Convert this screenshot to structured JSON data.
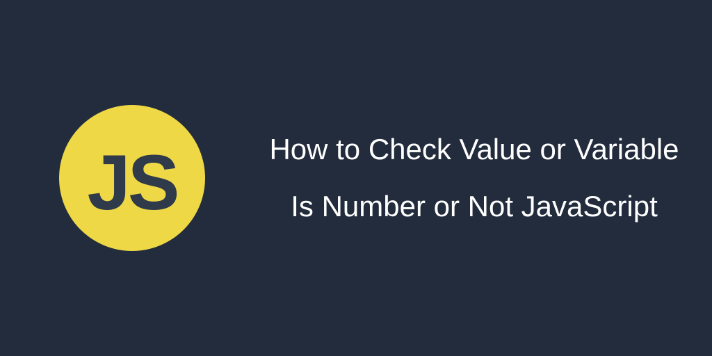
{
  "logo": {
    "text": "JS",
    "bg": "#efd846",
    "fg": "#2f3a4b"
  },
  "title": "How to Check Value or Variable Is Number or Not JavaScript",
  "background": "#222c3c"
}
